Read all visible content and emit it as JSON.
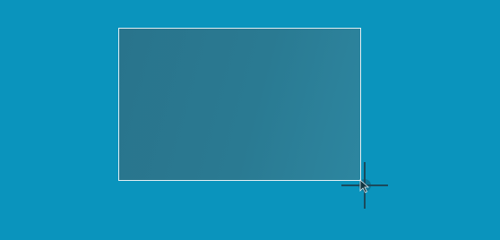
{
  "desktop": {
    "background_color": "#0a94bd"
  },
  "selection": {
    "fill_color": "#2a7a92",
    "border_color": "#ebf5fa"
  },
  "cursor": {
    "icon": "crosshair-cursor-icon",
    "color": "#1a4a5c"
  }
}
